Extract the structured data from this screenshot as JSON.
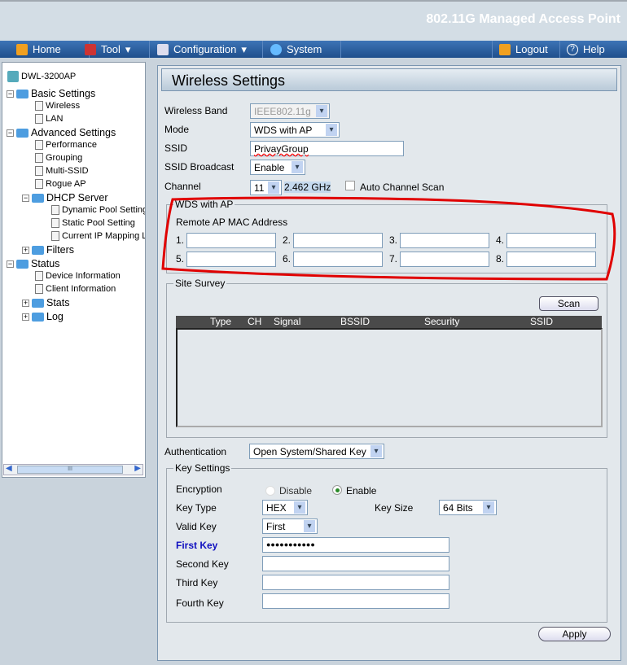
{
  "header": {
    "title": "802.11G Managed Access Point"
  },
  "nav": {
    "home": "Home",
    "tool": "Tool",
    "configuration": "Configuration",
    "system": "System",
    "logout": "Logout",
    "help": "Help"
  },
  "tree": {
    "root": "DWL-3200AP",
    "basic": "Basic Settings",
    "wireless": "Wireless",
    "lan": "LAN",
    "advanced": "Advanced Settings",
    "performance": "Performance",
    "grouping": "Grouping",
    "multi_ssid": "Multi-SSID",
    "rogue_ap": "Rogue AP",
    "dhcp": "DHCP Server",
    "dynamic_pool": "Dynamic Pool Setting",
    "static_pool": "Static Pool Setting",
    "ip_mapping": "Current IP Mapping L",
    "filters": "Filters",
    "status": "Status",
    "device_info": "Device Information",
    "client_info": "Client Information",
    "stats": "Stats",
    "log": "Log",
    "scroll_grip": "III"
  },
  "page": {
    "title": "Wireless Settings"
  },
  "form": {
    "band_label": "Wireless Band",
    "band": "IEEE802.11g",
    "mode_label": "Mode",
    "mode": "WDS with AP",
    "ssid_label": "SSID",
    "ssid": "PrivayGroup",
    "bcast_label": "SSID Broadcast",
    "bcast": "Enable",
    "channel_label": "Channel",
    "channel": "11",
    "freq": "2.462 GHz",
    "auto_scan": "Auto Channel Scan"
  },
  "wds": {
    "legend": "WDS with AP",
    "mac_label": "Remote AP MAC Address",
    "n": [
      "1.",
      "2.",
      "3.",
      "4.",
      "5.",
      "6.",
      "7.",
      "8."
    ]
  },
  "survey": {
    "legend": "Site Survey",
    "scan": "Scan",
    "cols": [
      "Type",
      "CH",
      "Signal",
      "BSSID",
      "Security",
      "SSID"
    ]
  },
  "auth": {
    "label": "Authentication",
    "value": "Open System/Shared Key"
  },
  "keys": {
    "legend": "Key Settings",
    "enc_label": "Encryption",
    "disable": "Disable",
    "enable": "Enable",
    "type_label": "Key Type",
    "type": "HEX",
    "size_label": "Key Size",
    "size": "64 Bits",
    "valid_label": "Valid Key",
    "valid": "First",
    "first": "First Key",
    "first_value": "●●●●●●●●●●●",
    "second": "Second Key",
    "third": "Third Key",
    "fourth": "Fourth Key"
  },
  "apply": "Apply",
  "colors": {
    "annotation": "#e00000",
    "nav": "#2c5e99",
    "first_key": "#1010c0"
  }
}
